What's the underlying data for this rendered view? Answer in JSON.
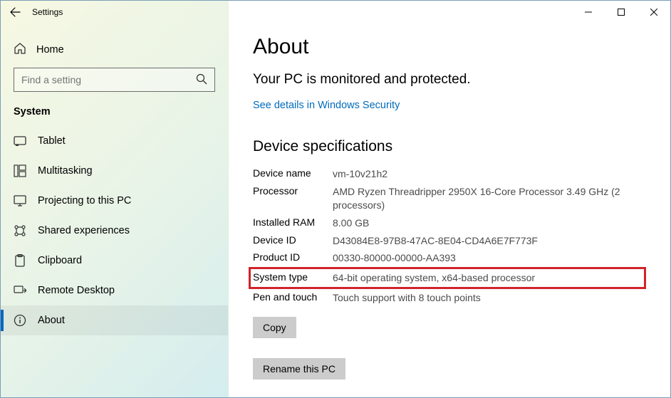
{
  "titlebar": {
    "title": "Settings"
  },
  "sidebar": {
    "home": "Home",
    "search_placeholder": "Find a setting",
    "section": "System",
    "items": [
      {
        "label": "Tablet"
      },
      {
        "label": "Multitasking"
      },
      {
        "label": "Projecting to this PC"
      },
      {
        "label": "Shared experiences"
      },
      {
        "label": "Clipboard"
      },
      {
        "label": "Remote Desktop"
      },
      {
        "label": "About"
      }
    ]
  },
  "about": {
    "title": "About",
    "status": "Your PC is monitored and protected.",
    "link": "See details in Windows Security",
    "spec_heading": "Device specifications",
    "specs": {
      "device_name_label": "Device name",
      "device_name": "vm-10v21h2",
      "processor_label": "Processor",
      "processor": "AMD Ryzen Threadripper 2950X 16-Core Processor 3.49 GHz  (2 processors)",
      "ram_label": "Installed RAM",
      "ram": "8.00 GB",
      "device_id_label": "Device ID",
      "device_id": "D43084E8-97B8-47AC-8E04-CD4A6E7F773F",
      "product_id_label": "Product ID",
      "product_id": "00330-80000-00000-AA393",
      "system_type_label": "System type",
      "system_type": "64-bit operating system, x64-based processor",
      "pen_touch_label": "Pen and touch",
      "pen_touch": "Touch support with 8 touch points"
    },
    "copy_btn": "Copy",
    "rename_btn": "Rename this PC"
  }
}
